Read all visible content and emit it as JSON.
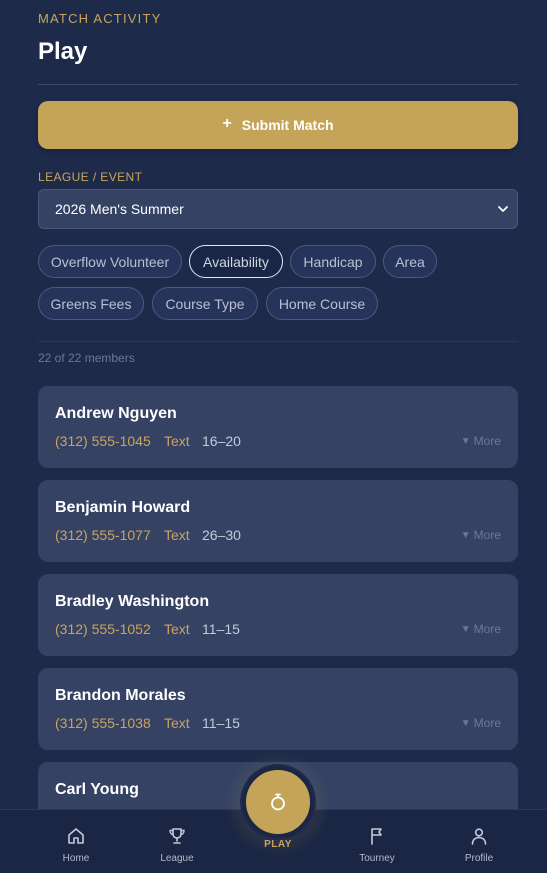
{
  "header": {
    "eyebrow": "MATCH ACTIVITY",
    "title": "Play"
  },
  "submit": {
    "icon": "plus-icon",
    "label": "Submit Match"
  },
  "league": {
    "label": "LEAGUE / EVENT",
    "selected": "2026 Men's Summer"
  },
  "filters": [
    {
      "label": "Overflow Volunteer",
      "active": false
    },
    {
      "label": "Availability",
      "active": true
    },
    {
      "label": "Handicap",
      "active": false
    },
    {
      "label": "Area",
      "active": false
    },
    {
      "label": "Greens Fees",
      "active": false
    },
    {
      "label": "Course Type",
      "active": false
    },
    {
      "label": "Home Course",
      "active": false
    }
  ],
  "member_count": "22 of 22 members",
  "members": [
    {
      "name": "Andrew Nguyen",
      "phone": "(312) 555-1045",
      "text_label": "Text",
      "range": "16–20",
      "more": "More"
    },
    {
      "name": "Benjamin Howard",
      "phone": "(312) 555-1077",
      "text_label": "Text",
      "range": "26–30",
      "more": "More"
    },
    {
      "name": "Bradley Washington",
      "phone": "(312) 555-1052",
      "text_label": "Text",
      "range": "11–15",
      "more": "More"
    },
    {
      "name": "Brandon Morales",
      "phone": "(312) 555-1038",
      "text_label": "Text",
      "range": "11–15",
      "more": "More"
    },
    {
      "name": "Carl Young"
    }
  ],
  "tabs": [
    {
      "label": "Home",
      "icon": "home-icon"
    },
    {
      "label": "League",
      "icon": "trophy-icon"
    },
    {
      "label": "PLAY",
      "icon": "golf-ball-icon"
    },
    {
      "label": "Tourney",
      "icon": "flag-icon"
    },
    {
      "label": "Profile",
      "icon": "user-icon"
    }
  ],
  "colors": {
    "background": "#1d2a4a",
    "accent_gold": "#c4a459",
    "card": "#354264",
    "tabbar": "#1a2644"
  }
}
